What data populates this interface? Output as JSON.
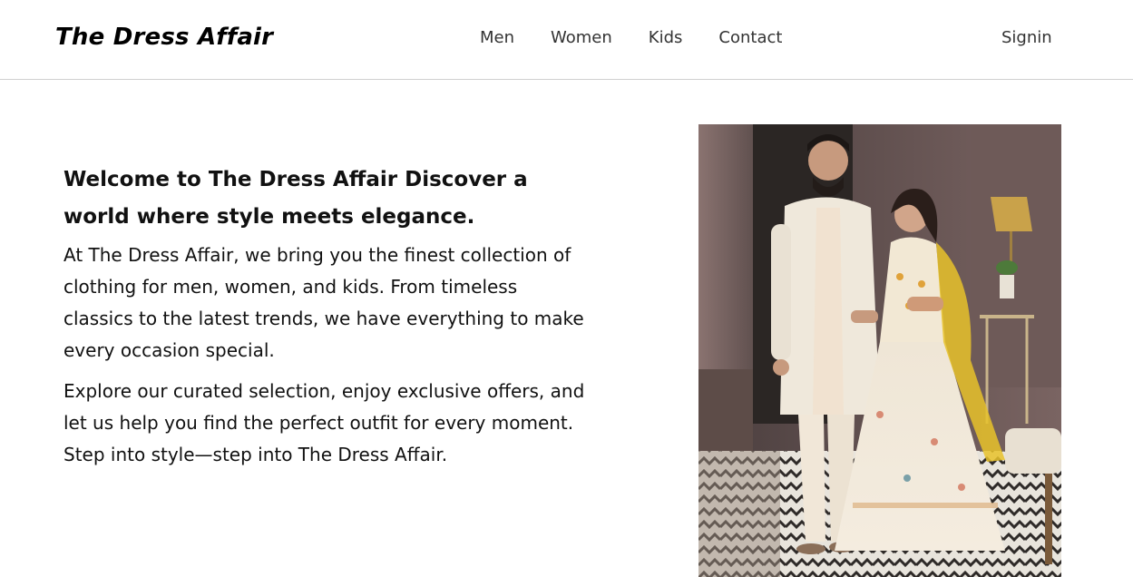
{
  "header": {
    "brand": "The Dress Affair",
    "nav": [
      "Men",
      "Women",
      "Kids",
      "Contact"
    ],
    "signin_label": "Signin"
  },
  "hero": {
    "heading": "Welcome to The Dress Affair Discover a world where style meets elegance.",
    "paragraphs": [
      "At The Dress Affair, we bring you the finest collection of clothing for men, women, and kids. From timeless classics to the latest trends, we have everything to make every occasion special.",
      "Explore our curated selection, enjoy exclusive offers, and let us help you find the perfect outfit for every moment. Step into style—step into The Dress Affair."
    ]
  },
  "colors": {
    "text": "#111111",
    "nav_text": "#333333",
    "divider": "#d0d0d0",
    "background": "#ffffff"
  }
}
